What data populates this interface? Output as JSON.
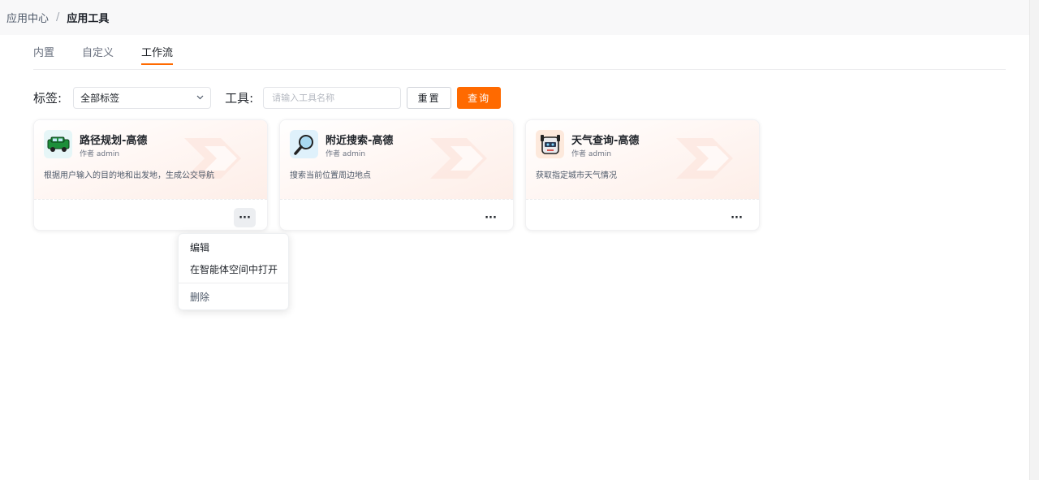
{
  "breadcrumb": {
    "items": [
      "应用中心",
      "应用工具"
    ],
    "separator": "/"
  },
  "tabs": [
    {
      "label": "内置",
      "active": false
    },
    {
      "label": "自定义",
      "active": false
    },
    {
      "label": "工作流",
      "active": true
    }
  ],
  "filters": {
    "tag_label": "标签:",
    "tag_value": "全部标签",
    "tool_label": "工具:",
    "tool_placeholder": "请输入工具名称",
    "reset_label": "重置",
    "query_label": "查询"
  },
  "cards": [
    {
      "title": "路径规划-高德",
      "author": "作者 admin",
      "description": "根据用户输入的目的地和出发地，生成公交导航",
      "icon": "car-icon",
      "more": "···"
    },
    {
      "title": "附近搜索-高德",
      "author": "作者 admin",
      "description": "搜索当前位置周边地点",
      "icon": "magnifier-icon",
      "more": "···"
    },
    {
      "title": "天气查询-高德",
      "author": "作者 admin",
      "description": "获取指定城市天气情况",
      "icon": "robot-icon",
      "more": "···"
    }
  ],
  "context_menu": {
    "items": [
      "编辑",
      "在智能体空间中打开",
      "删除"
    ]
  },
  "colors": {
    "accent": "#ff6a00",
    "topbar_bg": "#f8f8f9"
  }
}
